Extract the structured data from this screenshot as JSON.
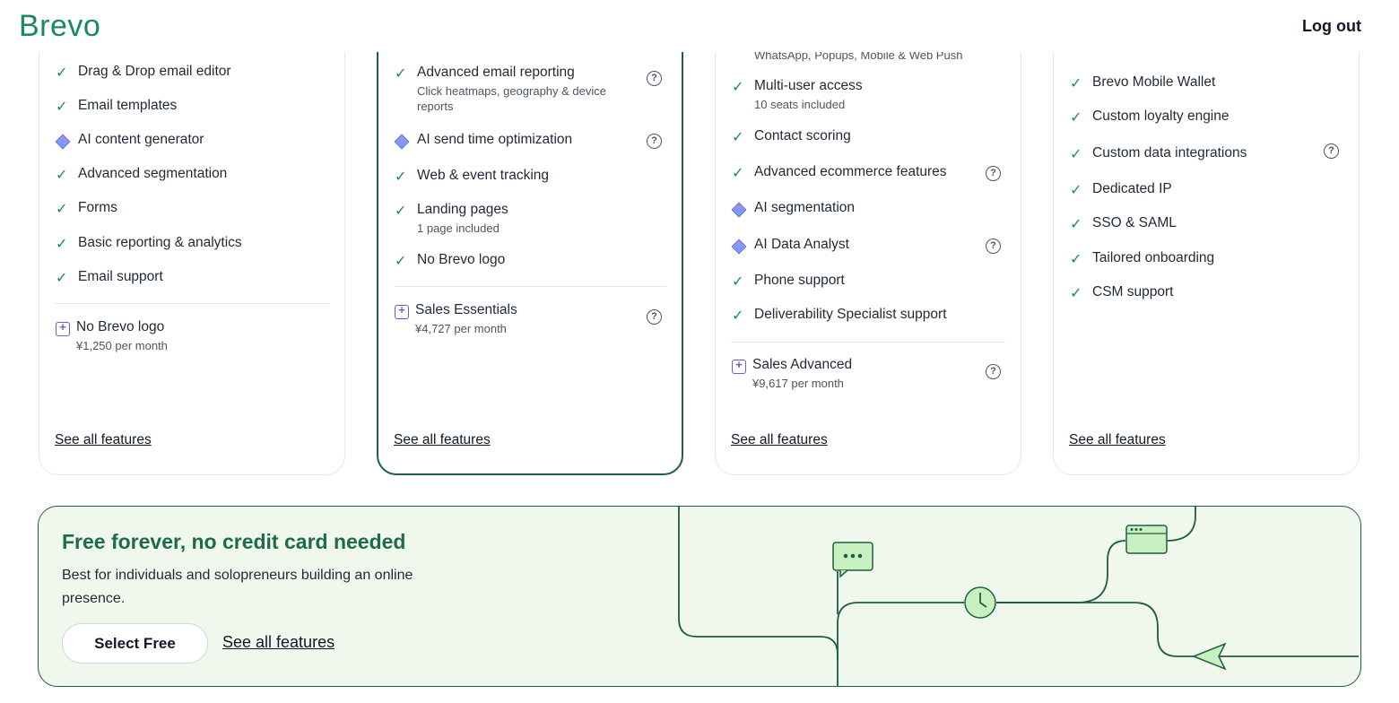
{
  "header": {
    "logo": "Brevo",
    "logout_label": "Log out"
  },
  "cards": [
    {
      "features": [
        {
          "icon": "check-icon",
          "label": "Drag & Drop email editor"
        },
        {
          "icon": "check-icon",
          "label": "Email templates"
        },
        {
          "icon": "ai-diamond-icon",
          "label": "AI content generator"
        },
        {
          "icon": "check-icon",
          "label": "Advanced segmentation"
        },
        {
          "icon": "check-icon",
          "label": "Forms"
        },
        {
          "icon": "check-icon",
          "label": "Basic reporting & analytics"
        },
        {
          "icon": "check-icon",
          "label": "Email support"
        }
      ],
      "addon": {
        "label": "No Brevo logo",
        "price": "¥1,250 per month"
      },
      "see_all": "See all features"
    },
    {
      "features": [
        {
          "icon": "check-icon",
          "label": "Advanced email reporting",
          "sub": "Click heatmaps, geography & device reports"
        },
        {
          "icon": "ai-diamond-icon",
          "label": "AI send time optimization"
        },
        {
          "icon": "check-icon",
          "label": "Web & event tracking"
        },
        {
          "icon": "check-icon",
          "label": "Landing pages",
          "sub": "1 page included"
        },
        {
          "icon": "check-icon",
          "label": "No Brevo logo"
        }
      ],
      "addon": {
        "label": "Sales Essentials",
        "price": "¥4,727 per month"
      },
      "see_all": "See all features"
    },
    {
      "top_partial": "WhatsApp, Popups, Mobile & Web Push",
      "features": [
        {
          "icon": "check-icon",
          "label": "Multi-user access",
          "sub": "10 seats included"
        },
        {
          "icon": "check-icon",
          "label": "Contact scoring"
        },
        {
          "icon": "check-icon",
          "label": "Advanced ecommerce features"
        },
        {
          "icon": "ai-diamond-icon",
          "label": "AI segmentation"
        },
        {
          "icon": "ai-diamond-icon",
          "label": "AI Data Analyst"
        },
        {
          "icon": "check-icon",
          "label": "Phone support"
        },
        {
          "icon": "check-icon",
          "label": "Deliverability Specialist support"
        }
      ],
      "addon": {
        "label": "Sales Advanced",
        "price": "¥9,617 per month"
      },
      "see_all": "See all features"
    },
    {
      "features": [
        {
          "icon": "check-icon",
          "label": "Brevo Mobile Wallet"
        },
        {
          "icon": "check-icon",
          "label": "Custom loyalty engine"
        },
        {
          "icon": "check-icon",
          "label": "Custom data integrations"
        },
        {
          "icon": "check-icon",
          "label": "Dedicated IP"
        },
        {
          "icon": "check-icon",
          "label": "SSO & SAML"
        },
        {
          "icon": "check-icon",
          "label": "Tailored onboarding"
        },
        {
          "icon": "check-icon",
          "label": "CSM support"
        }
      ],
      "see_all": "See all features"
    }
  ],
  "banner": {
    "title": "Free forever, no credit card needed",
    "description": "Best for individuals and solopreneurs building an online presence.",
    "select_label": "Select Free",
    "see_all": "See all features"
  },
  "colors": {
    "brand_green": "#1a8a5c",
    "dark_green": "#1e5e43",
    "banner_bg": "#f0f8ee",
    "addon_purple": "#6d5bd0"
  }
}
